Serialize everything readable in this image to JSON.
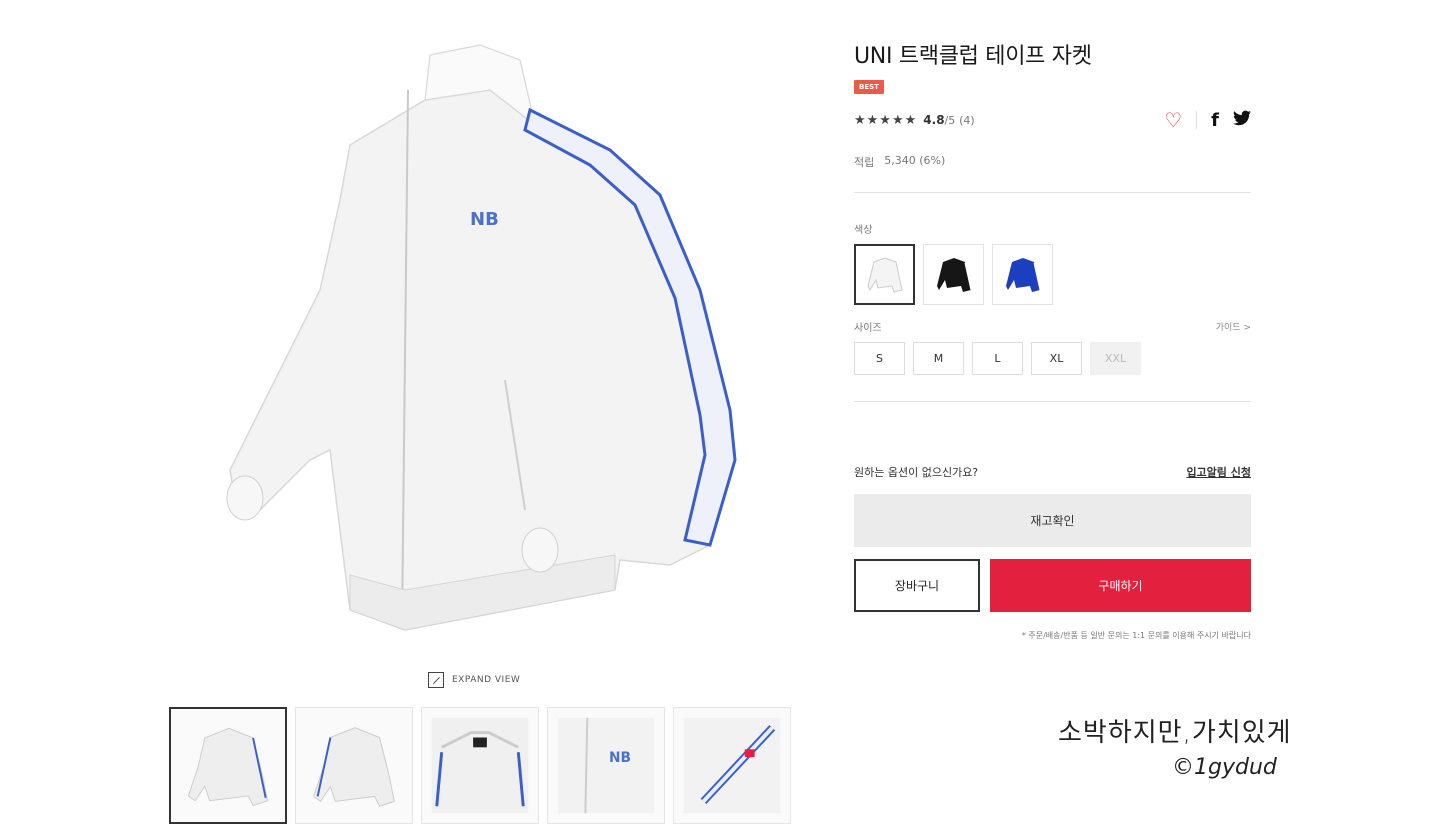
{
  "product": {
    "title": "UNI 트랙클럽 테이프 자켓",
    "badge": "BEST",
    "rating_stars": "★★★★★",
    "rating_score": "4.8",
    "rating_max": "/5",
    "rating_count": "(4)",
    "points_label": "적립",
    "points_value": "5,340 (6%)"
  },
  "share": {
    "heart_icon": "♡",
    "facebook_icon": "f",
    "twitter_icon": "🐦"
  },
  "color": {
    "label": "색상",
    "options": [
      "white",
      "black",
      "blue"
    ],
    "swatch_colors": [
      "#f4f4f4",
      "#161616",
      "#1c3fbf"
    ]
  },
  "size": {
    "label": "사이즈",
    "guide": "가이드 >",
    "options": [
      "S",
      "M",
      "L",
      "XL",
      "XXL"
    ]
  },
  "restock": {
    "question": "원하는 옵션이 없으신가요?",
    "link": "입고알림 신청"
  },
  "buttons": {
    "stock_check": "재고확인",
    "cart": "장바구니",
    "buy": "구매하기"
  },
  "notice": "* 주문/배송/반품 등 일반 문의는 1:1 문의를 이용해 주시기 바랍니다",
  "gallery": {
    "expand_label": "EXPAND VIEW",
    "thumbnails": [
      "front",
      "back",
      "collar",
      "logo",
      "sleeve-tape"
    ]
  },
  "watermark": {
    "line1": "소박하지만,가치있게",
    "line2": "©1gydud"
  },
  "colors": {
    "accent": "#e3213e",
    "badge": "#ef5a48",
    "tape_blue": "#3a5fc8"
  }
}
